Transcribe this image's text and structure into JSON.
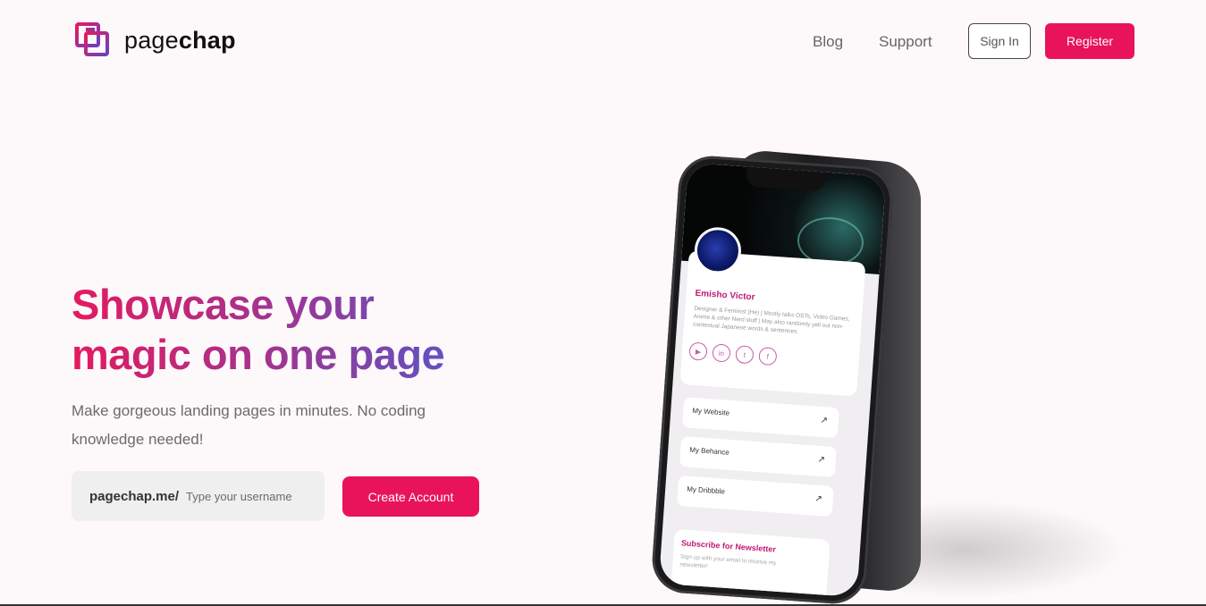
{
  "header": {
    "logo_text_light": "page",
    "logo_text_bold": "chap",
    "nav": {
      "blog": "Blog",
      "support": "Support"
    },
    "signin_label": "Sign In",
    "register_label": "Register"
  },
  "hero": {
    "headline_line1": "Showcase your",
    "headline_line2": "magic on one page",
    "subtext": "Make gorgeous landing pages in minutes. No coding knowledge needed!",
    "url_prefix": "pagechap.me/",
    "username_placeholder": "Type your username",
    "create_label": "Create Account"
  },
  "phone": {
    "profile_name": "Emisho Victor",
    "profile_bio": "Designer & Feminist (He) | Mostly talks OSTs, Video Games, Anime & other Nerd stuff | May also randomly yell out non-contextual Japanese words & sentences.",
    "links": [
      {
        "label": "My Website"
      },
      {
        "label": "My Behance"
      },
      {
        "label": "My Dribbble"
      }
    ],
    "newsletter_title": "Subscribe for Newsletter",
    "newsletter_sub": "Sign up with your email to receive my newsletter!"
  },
  "colors": {
    "brand": "#e8135b",
    "gradient_start": "#e41a5f",
    "gradient_mid": "#a4338f",
    "gradient_end": "#4d5bd0",
    "background": "#fdf8fa"
  },
  "icons": [
    "pagechap-logo-icon",
    "youtube-icon",
    "linkedin-icon",
    "twitter-icon",
    "facebook-icon",
    "arrow-up-right-icon"
  ]
}
